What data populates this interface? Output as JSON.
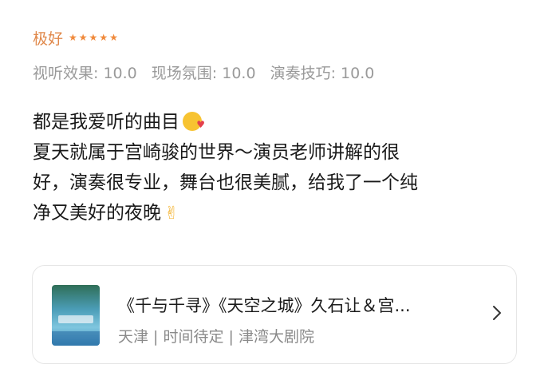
{
  "rating": {
    "label": "极好",
    "stars": 5
  },
  "scores": [
    "视听效果: 10.0",
    "现场氛围: 10.0",
    "演奏技巧: 10.0"
  ],
  "review": {
    "lines": [
      "都是我爱听的曲目",
      "夏天就属于宫崎骏的世界～演员老师讲解的很",
      "好，演奏很专业，舞台也很美腻，给我了一个纯",
      "净又美好的夜晚"
    ],
    "victory_emoji": "✌"
  },
  "event": {
    "title": "《千与千寻》《天空之城》久石让＆宫...",
    "meta": "天津 | 时间待定 | 津湾大剧院"
  },
  "icons": {
    "star": "★",
    "chevron": "chevron-right"
  },
  "colors": {
    "accent": "#f08a3c",
    "muted": "#9a9a9a",
    "text": "#1a1a1a"
  }
}
